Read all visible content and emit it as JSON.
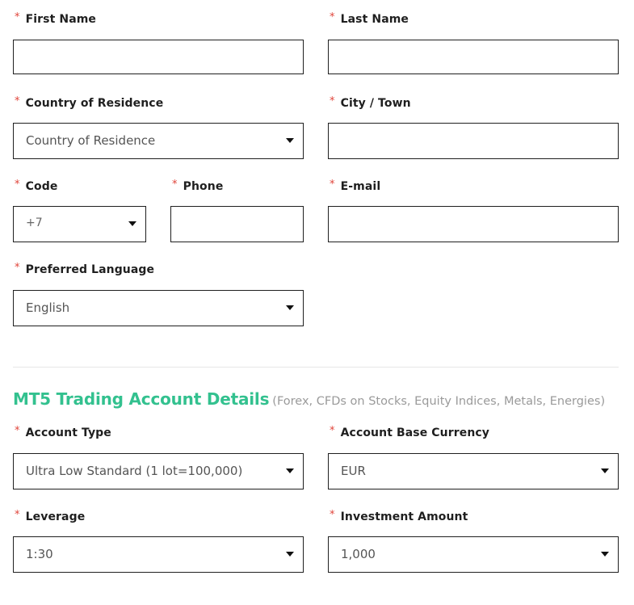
{
  "colors": {
    "accent": "#33c18f",
    "required": "#e0443a",
    "border": "#1f1f1f"
  },
  "required_mark": "*",
  "fields": {
    "first_name": {
      "label": "First Name",
      "value": ""
    },
    "last_name": {
      "label": "Last Name",
      "value": ""
    },
    "country": {
      "label": "Country of Residence",
      "selected": "Country of Residence"
    },
    "city": {
      "label": "City / Town",
      "value": ""
    },
    "code": {
      "label": "Code",
      "selected": "+7"
    },
    "phone": {
      "label": "Phone",
      "value": ""
    },
    "email": {
      "label": "E-mail",
      "value": ""
    },
    "language": {
      "label": "Preferred Language",
      "selected": "English"
    }
  },
  "section": {
    "title": "MT5 Trading Account Details",
    "subtitle": "(Forex, CFDs on Stocks, Equity Indices, Metals, Energies)"
  },
  "account": {
    "account_type": {
      "label": "Account Type",
      "selected": "Ultra Low Standard (1 lot=100,000)"
    },
    "base_currency": {
      "label": "Account Base Currency",
      "selected": "EUR"
    },
    "leverage": {
      "label": "Leverage",
      "selected": "1:30"
    },
    "investment": {
      "label": "Investment Amount",
      "selected": "1,000"
    }
  }
}
